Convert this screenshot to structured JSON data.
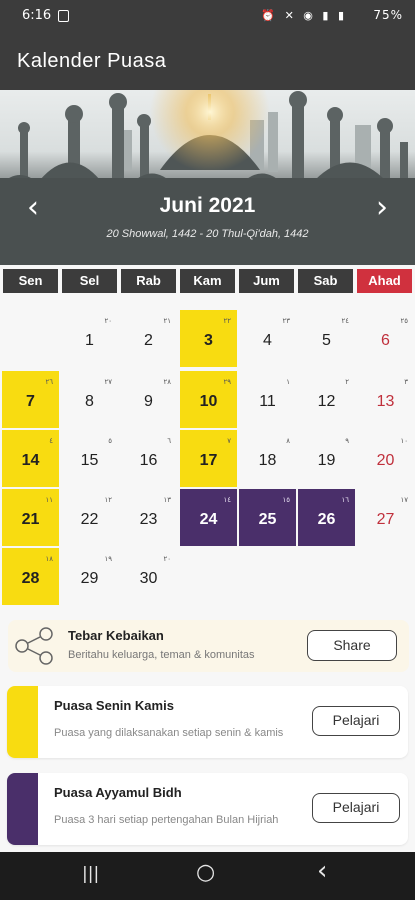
{
  "status_bar": {
    "time": "6:16",
    "icons": "⏰ ✕ ◉ ▮ ▮",
    "battery": "75%"
  },
  "app_bar": {
    "title": "Kalender Puasa"
  },
  "header": {
    "month": "Juni 2021",
    "hijri_range": "20 Showwal, 1442 - 20 Thul-Qi'dah, 1442",
    "prev_icon": "‹",
    "next_icon": "›"
  },
  "weekdays": [
    "Sen",
    "Sel",
    "Rab",
    "Kam",
    "Jum",
    "Sab",
    "Ahad"
  ],
  "calendar": {
    "days": [
      {
        "day": "1",
        "hijri": "٢٠"
      },
      {
        "day": "2",
        "hijri": "٢١"
      },
      {
        "day": "3",
        "hijri": "٢٢",
        "mark": "yellow"
      },
      {
        "day": "4",
        "hijri": "٢٣"
      },
      {
        "day": "5",
        "hijri": "٢٤"
      },
      {
        "day": "6",
        "hijri": "٢٥"
      },
      {
        "day": "7",
        "hijri": "٢٦",
        "mark": "yellow"
      },
      {
        "day": "8",
        "hijri": "٢٧"
      },
      {
        "day": "9",
        "hijri": "٢٨"
      },
      {
        "day": "10",
        "hijri": "٢٩",
        "mark": "yellow"
      },
      {
        "day": "11",
        "hijri": "١"
      },
      {
        "day": "12",
        "hijri": "٢"
      },
      {
        "day": "13",
        "hijri": "٣"
      },
      {
        "day": "14",
        "hijri": "٤",
        "mark": "yellow"
      },
      {
        "day": "15",
        "hijri": "٥"
      },
      {
        "day": "16",
        "hijri": "٦"
      },
      {
        "day": "17",
        "hijri": "٧",
        "mark": "yellow"
      },
      {
        "day": "18",
        "hijri": "٨"
      },
      {
        "day": "19",
        "hijri": "٩"
      },
      {
        "day": "20",
        "hijri": "١٠"
      },
      {
        "day": "21",
        "hijri": "١١",
        "mark": "yellow"
      },
      {
        "day": "22",
        "hijri": "١٢"
      },
      {
        "day": "23",
        "hijri": "١٣"
      },
      {
        "day": "24",
        "hijri": "١٤",
        "mark": "purple"
      },
      {
        "day": "25",
        "hijri": "١٥",
        "mark": "purple"
      },
      {
        "day": "26",
        "hijri": "١٦",
        "mark": "purple"
      },
      {
        "day": "27",
        "hijri": "١٧"
      },
      {
        "day": "28",
        "hijri": "١٨",
        "mark": "yellow"
      },
      {
        "day": "29",
        "hijri": "١٩"
      },
      {
        "day": "30",
        "hijri": "٢٠"
      }
    ]
  },
  "share_card": {
    "title": "Tebar Kebaikan",
    "subtitle": "Beritahu keluarga, teman & komunitas",
    "button": "Share"
  },
  "info_cards": [
    {
      "title": "Puasa Senin Kamis",
      "description": "Puasa yang dilaksanakan setiap senin & kamis",
      "button": "Pelajari",
      "color": "#f8dc11"
    },
    {
      "title": "Puasa Ayyamul Bidh",
      "description": "Puasa 3 hari setiap pertengahan Bulan Hijriah",
      "button": "Pelajari",
      "color": "#4a2f6a"
    }
  ],
  "colors": {
    "dark": "#3c3c3c",
    "sunday": "#d0313e",
    "yellow": "#f8dc11",
    "purple": "#4a2f6a",
    "thursday_text": "#2e8b2e"
  },
  "nav_bar": {
    "recent": "|||",
    "home": "○",
    "back": "‹"
  }
}
